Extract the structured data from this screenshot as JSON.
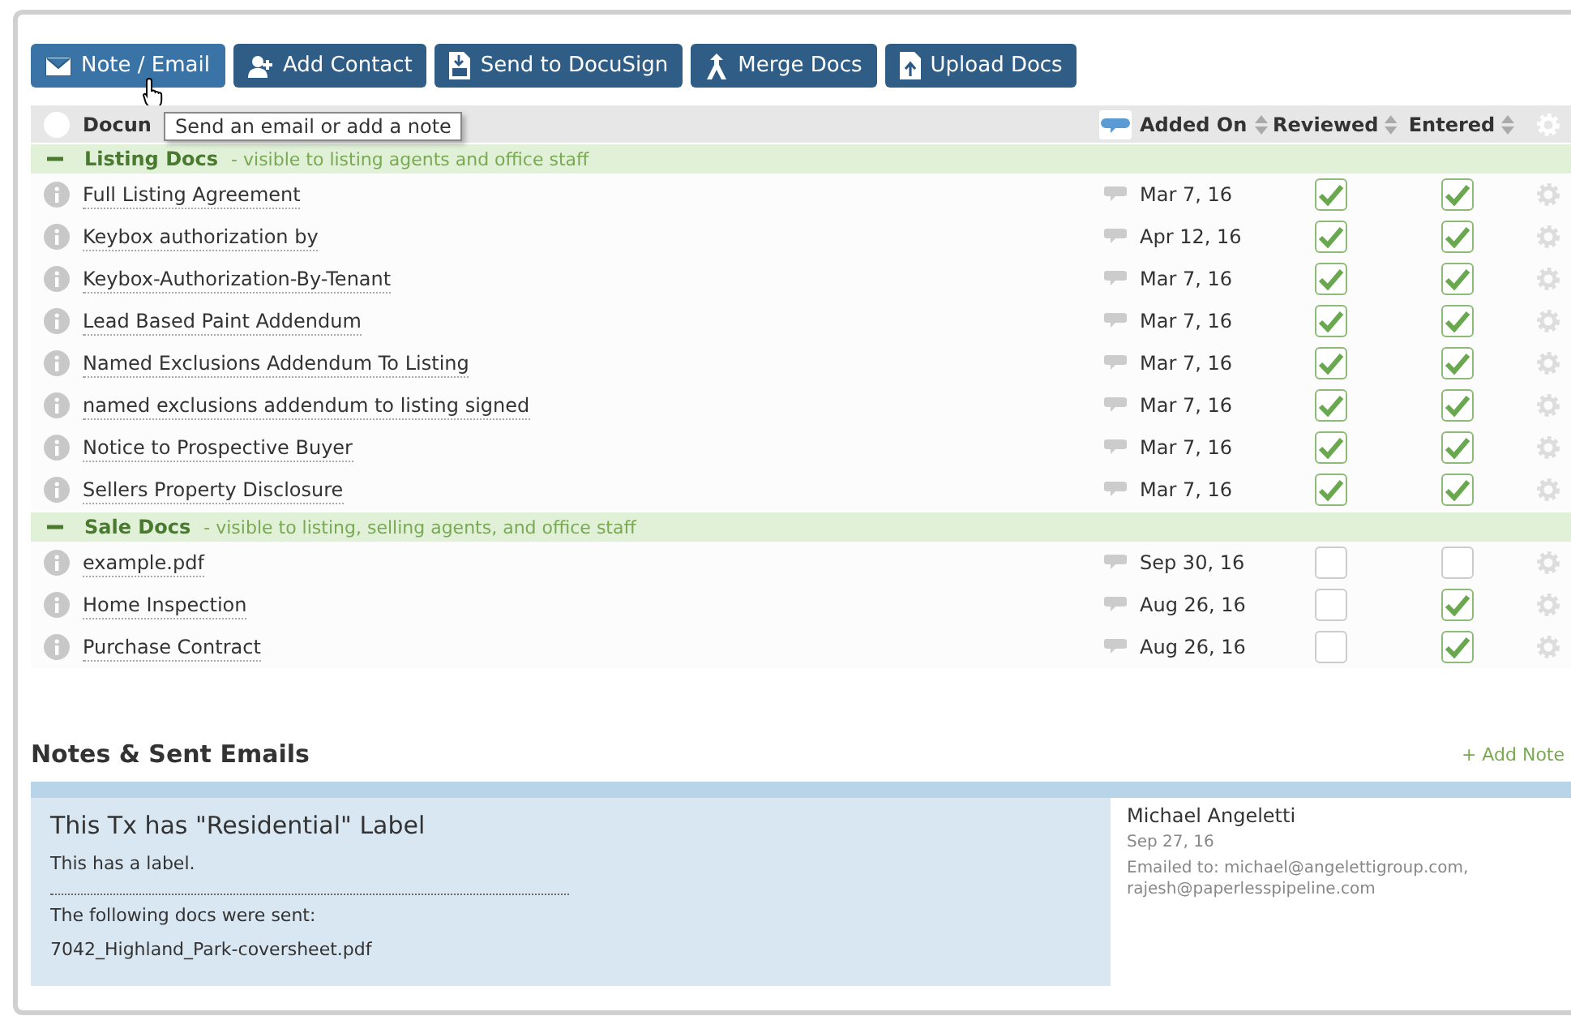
{
  "toolbar": [
    {
      "label": "Note / Email",
      "kind": "envelope"
    },
    {
      "label": "Add Contact",
      "kind": "person"
    },
    {
      "label": "Send to DocuSign",
      "kind": "docusign"
    },
    {
      "label": "Merge Docs",
      "kind": "merge"
    },
    {
      "label": "Upload Docs",
      "kind": "upload"
    }
  ],
  "tooltip": "Send an email or add a note",
  "columns": {
    "document": "Docun",
    "added": "Added On",
    "reviewed": "Reviewed",
    "entered": "Entered"
  },
  "groups": [
    {
      "name": "Listing Docs",
      "note": "- visible to listing agents and office staff",
      "expanded": true,
      "rows": [
        {
          "name": "Full Listing Agreement",
          "added": "Mar 7, 16",
          "reviewed": true,
          "entered": true
        },
        {
          "name": "Keybox authorization by",
          "added": "Apr 12, 16",
          "reviewed": true,
          "entered": true
        },
        {
          "name": "Keybox-Authorization-By-Tenant",
          "added": "Mar 7, 16",
          "reviewed": true,
          "entered": true
        },
        {
          "name": "Lead Based Paint Addendum",
          "added": "Mar 7, 16",
          "reviewed": true,
          "entered": true
        },
        {
          "name": "Named Exclusions Addendum To Listing",
          "added": "Mar 7, 16",
          "reviewed": true,
          "entered": true
        },
        {
          "name": "named exclusions addendum to listing signed",
          "added": "Mar 7, 16",
          "reviewed": true,
          "entered": true
        },
        {
          "name": "Notice to Prospective Buyer",
          "added": "Mar 7, 16",
          "reviewed": true,
          "entered": true
        },
        {
          "name": "Sellers Property Disclosure",
          "added": "Mar 7, 16",
          "reviewed": true,
          "entered": true
        }
      ]
    },
    {
      "name": "Sale Docs",
      "note": "- visible to listing, selling agents, and office staff",
      "expanded": true,
      "rows": [
        {
          "name": "example.pdf",
          "added": "Sep 30, 16",
          "reviewed": false,
          "entered": false
        },
        {
          "name": "Home Inspection",
          "added": "Aug 26, 16",
          "reviewed": false,
          "entered": true
        },
        {
          "name": "Purchase Contract",
          "added": "Aug 26, 16",
          "reviewed": false,
          "entered": true
        }
      ]
    }
  ],
  "notes": {
    "title": "Notes & Sent Emails",
    "add_link": "+ Add Note",
    "items": [
      {
        "heading": "This Tx has \"Residential\" Label",
        "body": "This has a label.",
        "sent_intro": "The following docs were sent:",
        "file": "7042_Highland_Park-coversheet.pdf",
        "author": "Michael Angeletti",
        "date": "Sep 27, 16",
        "emailed": "Emailed to: michael@angelettigroup.com, rajesh@paperlesspipeline.com"
      }
    ]
  }
}
